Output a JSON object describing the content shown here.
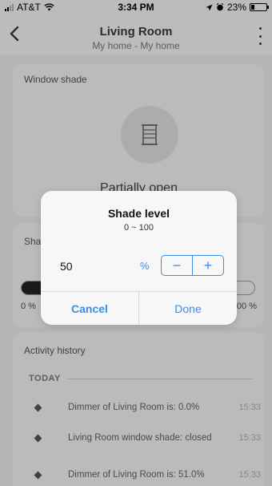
{
  "status_bar": {
    "carrier": "AT&T",
    "time": "3:34 PM",
    "battery": "23%",
    "battery_level": 0.23
  },
  "header": {
    "title": "Living Room",
    "subtitle": "My home - My home"
  },
  "shade_card": {
    "label": "Window shade",
    "state": "Partially open"
  },
  "level_card": {
    "label": "Sha",
    "min_label": "0 %",
    "max_label": "00 %",
    "value": 50
  },
  "activity": {
    "label": "Activity history",
    "today": "TODAY",
    "items": [
      {
        "text": "Dimmer of Living Room is: 0.0%",
        "time": "15:33"
      },
      {
        "text": "Living Room window shade: closed",
        "time": "15:33"
      },
      {
        "text": "Dimmer of Living Room is: 51.0%",
        "time": "15:33"
      }
    ]
  },
  "dialog": {
    "title": "Shade level",
    "range": "0 ~ 100",
    "value": "50",
    "unit": "%",
    "minus": "−",
    "plus": "+",
    "cancel": "Cancel",
    "done": "Done"
  },
  "colors": {
    "accent": "#3a8ee8",
    "card": "#d5d5d5",
    "dialog_bg": "#f7f7f7"
  }
}
